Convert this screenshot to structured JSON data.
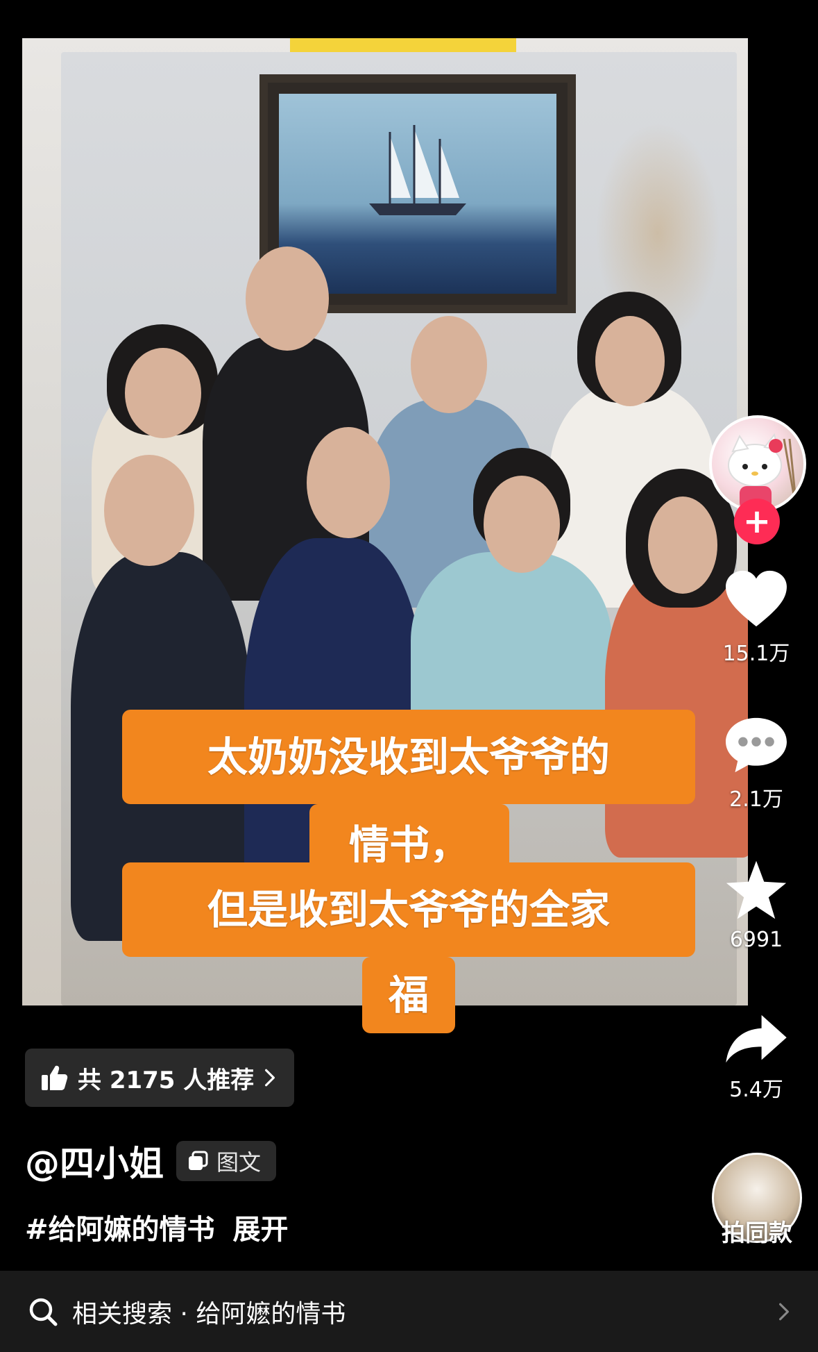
{
  "caption": {
    "line1": "太奶奶没收到太爷爷的",
    "line2": "情书，",
    "line3": "但是收到太爷爷的全家",
    "line4": "福"
  },
  "rail": {
    "likes": "15.1万",
    "comments": "2.1万",
    "favorites": "6991",
    "shares": "5.4万",
    "follow_label": "+"
  },
  "recommend": {
    "label": "共 2175 人推荐"
  },
  "author": {
    "name": "@四小姐",
    "type_label": "图文"
  },
  "description": {
    "hashtag": "#给阿嫲的情书",
    "expand": "展开"
  },
  "same_style": {
    "label": "拍同款"
  },
  "related_search": {
    "text": "相关搜索 · 给阿嬷的情书"
  },
  "colors": {
    "accent_orange": "#f2861e",
    "follow_red": "#fe2c55",
    "background": "#000000"
  }
}
